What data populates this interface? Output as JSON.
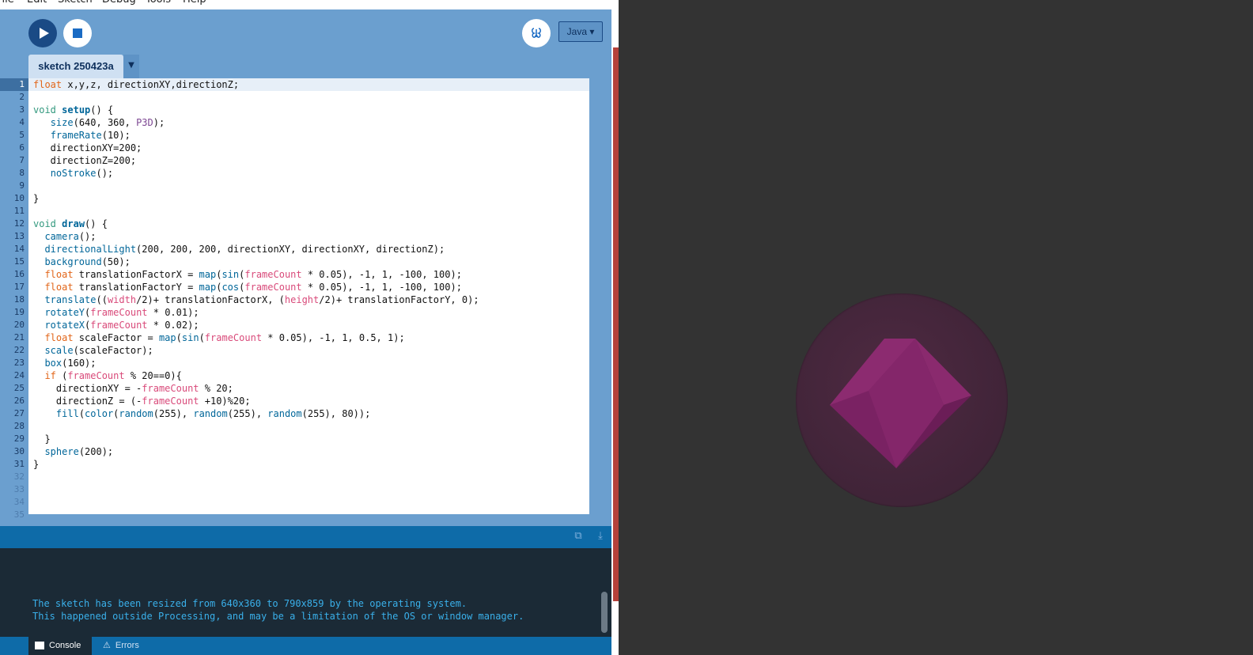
{
  "menu": [
    "File",
    "Edit",
    "Sketch",
    "Debug",
    "Tools",
    "Help"
  ],
  "toolbar": {
    "run_icon": "play-icon",
    "stop_icon": "stop-icon",
    "debugger_icon": "butterfly-icon",
    "mode": "Java ▾"
  },
  "tab": {
    "name": "sketch 250423a",
    "menu_glyph": "▼"
  },
  "editor": {
    "line_numbers": [
      "1",
      "2",
      "3",
      "4",
      "5",
      "6",
      "7",
      "8",
      "9",
      "10",
      "11",
      "12",
      "13",
      "14",
      "15",
      "16",
      "17",
      "18",
      "19",
      "20",
      "21",
      "22",
      "23",
      "24",
      "25",
      "26",
      "27",
      "28",
      "29",
      "30",
      "31",
      "32",
      "33",
      "34",
      "35"
    ],
    "lines": [
      "float x,y,z, directionXY,directionZ;",
      "",
      "void setup() {",
      "   size(640, 360, P3D);",
      "   frameRate(10);",
      "   directionXY=200;",
      "   directionZ=200;",
      "   noStroke();",
      "",
      "}",
      "",
      "void draw() {",
      "  camera();",
      "  directionalLight(200, 200, 200, directionXY, directionXY, directionZ);",
      "  background(50);",
      "  float translationFactorX = map(sin(frameCount * 0.05), -1, 1, -100, 100);",
      "  float translationFactorY = map(cos(frameCount * 0.05), -1, 1, -100, 100);",
      "  translate((width/2)+ translationFactorX, (height/2)+ translationFactorY, 0);",
      "  rotateY(frameCount * 0.01);",
      "  rotateX(frameCount * 0.02);",
      "  float scaleFactor = map(sin(frameCount * 0.05), -1, 1, 0.5, 1);",
      "  scale(scaleFactor);",
      "  box(160);",
      "  if (frameCount % 20==0){",
      "    directionXY = -frameCount % 20;",
      "    directionZ = (-frameCount +10)%20;",
      "    fill(color(random(255), random(255), random(255), 80));",
      "",
      "  }",
      "  sphere(200);",
      "}"
    ]
  },
  "console": {
    "lines": [
      "The sketch has been resized from 640x360 to 790x859 by the operating system.",
      "This happened outside Processing, and may be a limitation of the OS or window manager."
    ]
  },
  "status_tabs": {
    "console": "Console",
    "errors": "Errors"
  },
  "colors": {
    "ide_bg": "#6b9fcf",
    "run_button": "#1a4a85",
    "console_text": "#3ab0ea",
    "output_bg": "#333333",
    "cube_magenta": "#8a2a6e"
  }
}
